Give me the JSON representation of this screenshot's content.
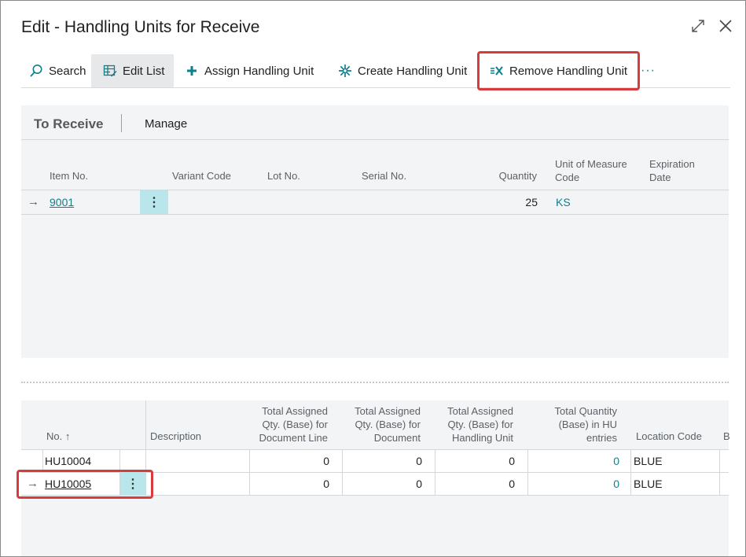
{
  "window": {
    "title": "Edit - Handling Units for Receive",
    "expand_icon": "expand-icon",
    "close_icon": "close-icon"
  },
  "actions": {
    "search": "Search",
    "edit_list": "Edit List",
    "assign": "Assign Handling Unit",
    "create": "Create Handling Unit",
    "remove": "Remove Handling Unit",
    "more": "···"
  },
  "receive_panel": {
    "title": "To Receive",
    "manage": "Manage",
    "columns": {
      "item_no": "Item No.",
      "variant_code": "Variant Code",
      "lot_no": "Lot No.",
      "serial_no": "Serial No.",
      "quantity": "Quantity",
      "uom_line1": "Unit of Measure",
      "uom_line2": "Code",
      "exp_line1": "Expiration",
      "exp_line2": "Date"
    },
    "rows": [
      {
        "item_no": "9001",
        "quantity": "25",
        "uom": "KS"
      }
    ]
  },
  "hu_panel": {
    "columns": {
      "no": "No. ↑",
      "description": "Description",
      "c1_l1": "Total Assigned",
      "c1_l2": "Qty. (Base) for",
      "c1_l3": "Document Line",
      "c2_l1": "Total Assigned",
      "c2_l2": "Qty. (Base) for",
      "c2_l3": "Document",
      "c3_l1": "Total Assigned",
      "c3_l2": "Qty. (Base) for",
      "c3_l3": "Handling Unit",
      "c4_l1": "Total Quantity",
      "c4_l2": "(Base) in HU",
      "c4_l3": "entries",
      "location": "Location Code",
      "next": "B"
    },
    "rows": [
      {
        "no": "HU10004",
        "doc_line": "0",
        "doc": "0",
        "hu": "0",
        "entries": "0",
        "location": "BLUE"
      },
      {
        "no": "HU10005",
        "doc_line": "0",
        "doc": "0",
        "hu": "0",
        "entries": "0",
        "location": "BLUE"
      }
    ]
  },
  "colors": {
    "accent": "#0f7f8c",
    "highlight": "#d73b3b",
    "selected_cell": "#b8e6ea"
  }
}
